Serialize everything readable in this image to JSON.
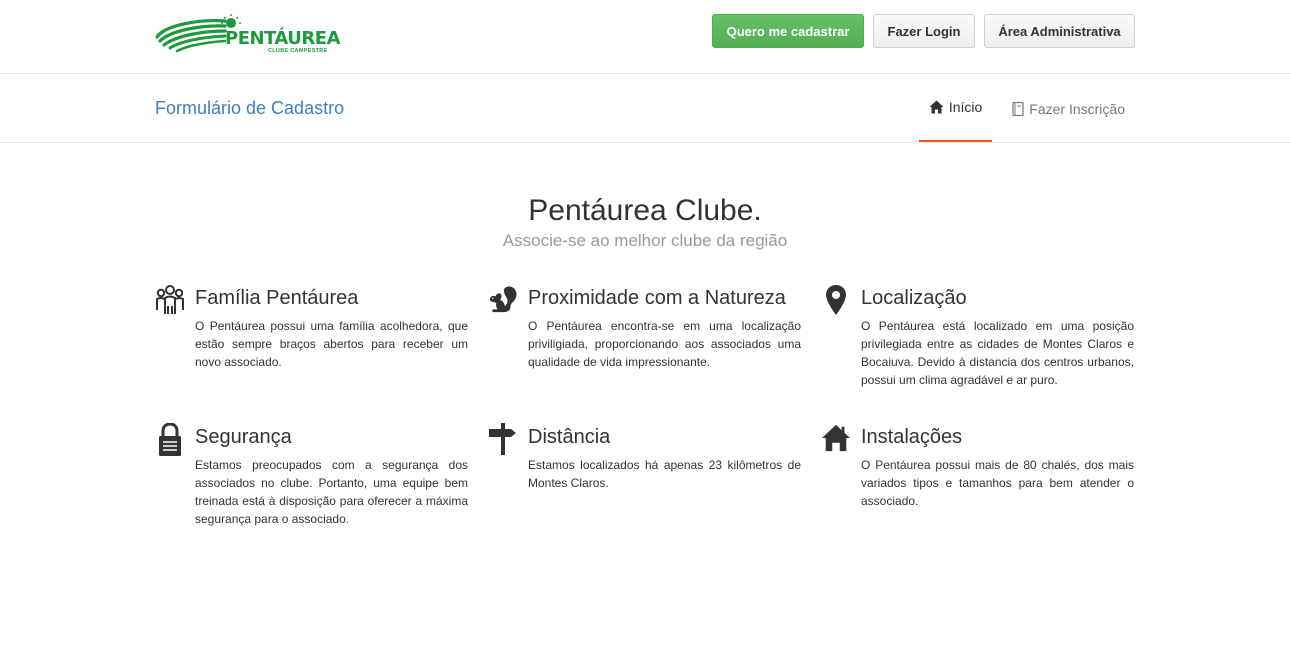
{
  "header": {
    "logo": {
      "brand": "PENTÁUREA",
      "subtitle": "CLUBE CAMPESTRE",
      "color": "#1d9a3d"
    },
    "buttons": {
      "register": "Quero me cadastrar",
      "login": "Fazer Login",
      "admin": "Área Administrativa"
    }
  },
  "navbar": {
    "title": "Formulário de Cadastro",
    "items": [
      {
        "label": "Início",
        "icon": "home-icon",
        "active": true
      },
      {
        "label": "Fazer Inscrição",
        "icon": "book-icon",
        "active": false
      }
    ],
    "accent": "#e85a13"
  },
  "hero": {
    "title": "Pentáurea Clube.",
    "subtitle": "Associe-se ao melhor clube da região"
  },
  "features": [
    {
      "icon": "family-icon",
      "title": "Família Pentáurea",
      "text": "O Pentáurea possui uma família acolhedora, que estão sempre braços abertos para receber um novo associado."
    },
    {
      "icon": "squirrel-icon",
      "title": "Proximidade com a Natureza",
      "text": "O Pentáurea encontra-se em uma localização priviligiada, proporcionando aos associados uma qualidade de vida impressionante."
    },
    {
      "icon": "map-marker-icon",
      "title": "Localização",
      "text": "O Pentáurea está localizado em uma posição privilegiada entre as cidades de Montes Claros e Bocaiuva. Devido à distancia dos centros urbanos, possui um clima agradável e ar puro."
    },
    {
      "icon": "lock-icon",
      "title": "Segurança",
      "text": "Estamos preocupados com a segurança dos associados no clube. Portanto, uma equipe bem treinada está à disposição para oferecer a máxima segurança para o associado."
    },
    {
      "icon": "signpost-icon",
      "title": "Distância",
      "text": "Estamos localizados há apenas 23 kilômetros de Montes Claros."
    },
    {
      "icon": "house-icon",
      "title": "Instalações",
      "text": "O Pentáurea possui mais de 80 chalés, dos mais variados tipos e tamanhos para bem atender o associado."
    }
  ]
}
